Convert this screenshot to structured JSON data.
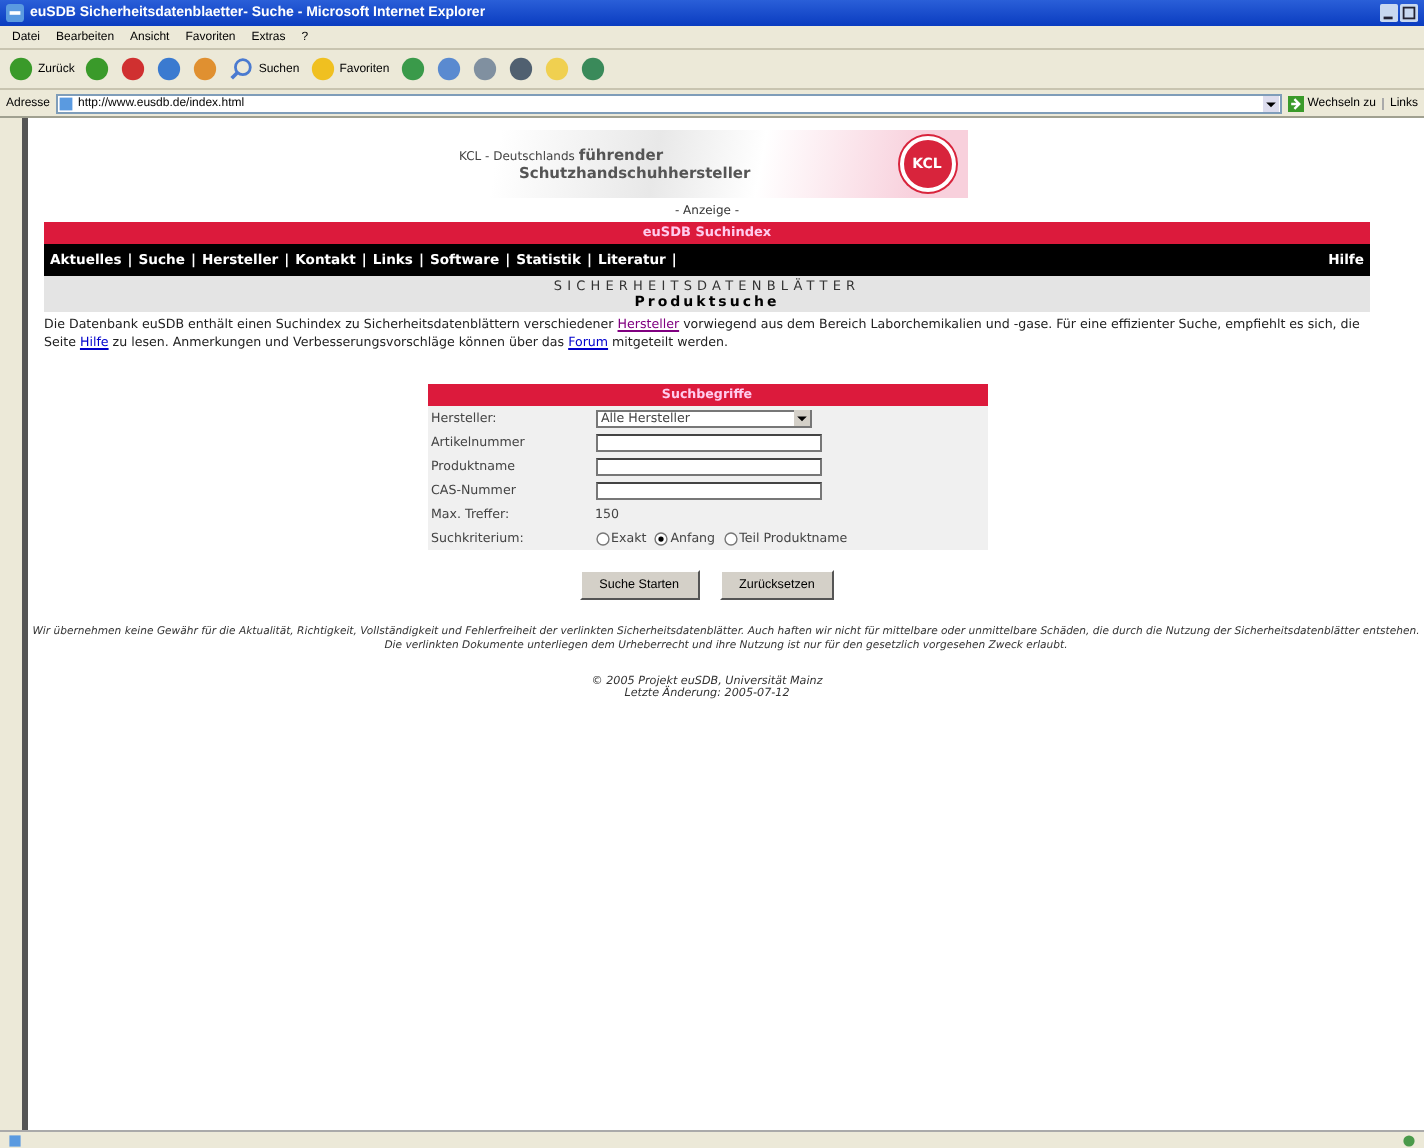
{
  "window": {
    "title": "euSDB Sicherheitsdatenblaetter- Suche - Microsoft Internet Explorer"
  },
  "menu": [
    "Datei",
    "Bearbeiten",
    "Ansicht",
    "Favoriten",
    "Extras",
    "?"
  ],
  "toolbar": [
    {
      "kind": "back",
      "label": "Zurück"
    },
    {
      "kind": "forward"
    },
    {
      "kind": "stop"
    },
    {
      "kind": "refresh"
    },
    {
      "kind": "home"
    },
    {
      "kind": "search",
      "label": "Suchen"
    },
    {
      "kind": "favorites",
      "label": "Favoriten"
    },
    {
      "kind": "history"
    },
    {
      "kind": "mail"
    },
    {
      "kind": "print"
    },
    {
      "kind": "edit"
    },
    {
      "kind": "folder"
    },
    {
      "kind": "messenger"
    }
  ],
  "address": {
    "label": "Adresse",
    "url": "http://www.eusdb.de/index.html",
    "go": "Wechseln zu",
    "links": "Links"
  },
  "banner": {
    "line1a": "KCL - Deutschlands",
    "line1b": "führender",
    "line2": "Schutzhandschuhhersteller",
    "logo": "KCL",
    "ad_label": "- Anzeige -"
  },
  "header": "euSDB Suchindex",
  "nav": [
    {
      "label": "Aktuelles",
      "separator": "|"
    },
    {
      "label": "Suche",
      "separator": "|"
    },
    {
      "label": "Hersteller",
      "separator": "|"
    },
    {
      "label": "Kontakt",
      "separator": "|"
    },
    {
      "label": "Links",
      "separator": "|"
    },
    {
      "label": "Software",
      "separator": "|"
    },
    {
      "label": "Statistik",
      "separator": "|"
    },
    {
      "label": "Literatur",
      "separator": "|"
    }
  ],
  "nav_help": "Hilfe",
  "section": {
    "title": "SICHERHEITSDATENBLÄTTER",
    "subtitle": "Produktsuche"
  },
  "intro": [
    {
      "kind": "text",
      "text": "Die Datenbank euSDB enthält einen Suchindex zu Sicherheitsdatenblättern verschiedener "
    },
    {
      "kind": "link",
      "text": "Hersteller",
      "visited": true
    },
    {
      "kind": "text",
      "text": " vorwiegend aus dem Bereich Laborchemikalien und -gase. Für eine effizienter Suche, empfiehlt es sich, die Seite "
    },
    {
      "kind": "link",
      "text": "Hilfe",
      "visited": false
    },
    {
      "kind": "text",
      "text": " zu lesen. Anmerkungen und Verbesserungsvorschläge können über das "
    },
    {
      "kind": "link",
      "text": "Forum",
      "visited": false
    },
    {
      "kind": "text",
      "text": " mitgeteilt werden."
    }
  ],
  "form": {
    "title": "Suchbegriffe",
    "rows": [
      {
        "kind": "select",
        "label": "Hersteller:",
        "value": "Alle Hersteller"
      },
      {
        "kind": "input",
        "label": "Artikelnummer"
      },
      {
        "kind": "input",
        "label": "Produktname"
      },
      {
        "kind": "input",
        "label": "CAS-Nummer"
      },
      {
        "kind": "text",
        "label": "Max. Treffer:",
        "value": "150"
      },
      {
        "kind": "radio",
        "label": "Suchkriterium:",
        "options": [
          {
            "label": "Exakt",
            "selected": false
          },
          {
            "label": "Anfang",
            "selected": true
          },
          {
            "label": "Teil Produktname",
            "selected": false
          }
        ]
      }
    ]
  },
  "buttons": [
    "Suche Starten",
    "Zurücksetzen"
  ],
  "disclaimer": "Wir übernehmen keine Gewähr für die Aktualität, Richtigkeit, Vollständigkeit und Fehlerfreiheit der verlinkten Sicherheitsdatenblätter. Auch haften wir nicht für mittelbare oder unmittelbare Schäden, die durch die Nutzung der Sicherheitsdatenblätter entstehen. Die verlinkten Dokumente unterliegen dem Urheberrecht und ihre Nutzung ist nur für den gesetzlich vorgesehen Zweck erlaubt.",
  "footer": [
    "© 2005 Projekt euSDB, Universität Mainz",
    "Letzte Änderung: 2005-07-12"
  ]
}
